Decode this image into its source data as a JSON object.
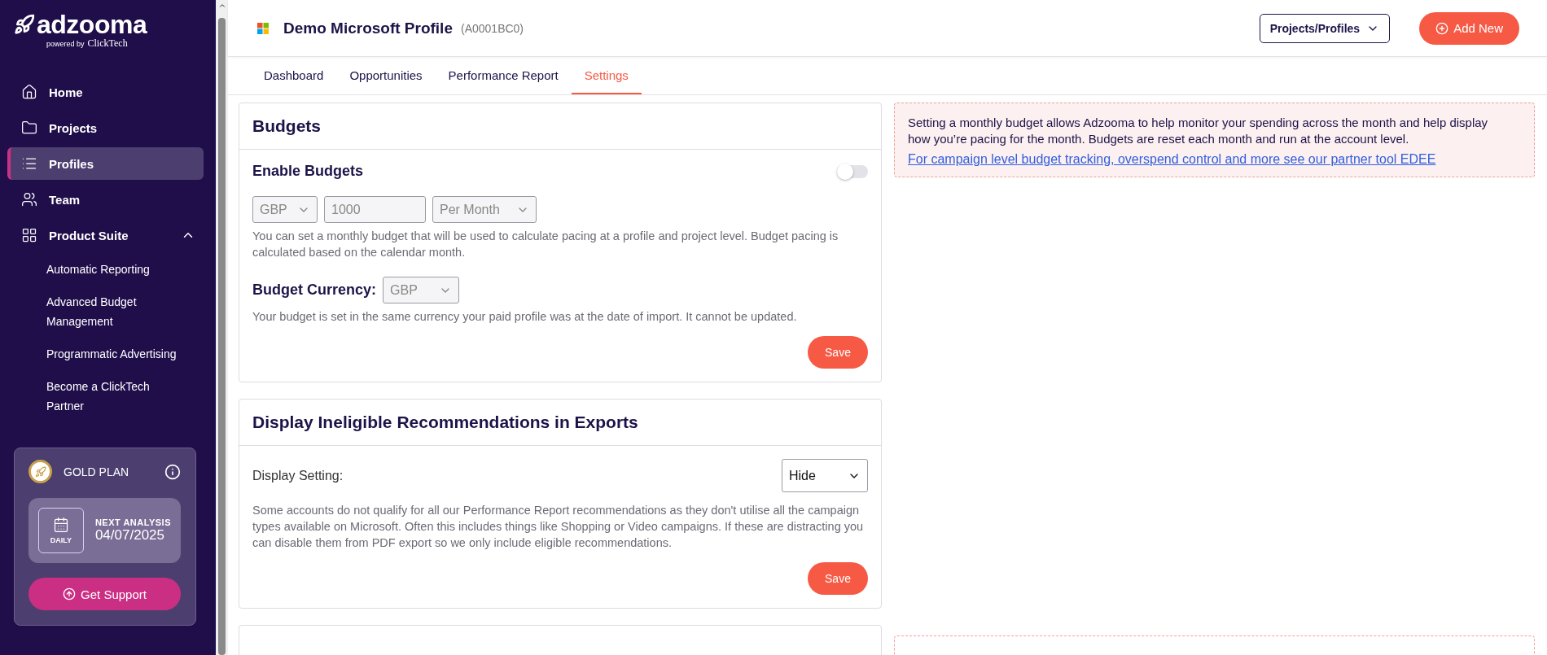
{
  "sidebar": {
    "logo": {
      "name": "adzooma",
      "tagline": "powered by",
      "brand": "ClickTech"
    },
    "items": [
      {
        "label": "Home",
        "selected": false
      },
      {
        "label": "Projects",
        "selected": false
      },
      {
        "label": "Profiles",
        "selected": true
      },
      {
        "label": "Team",
        "selected": false
      },
      {
        "label": "Product Suite",
        "selected": false,
        "expanded": true,
        "children": [
          {
            "label": "Automatic Reporting"
          },
          {
            "label": "Advanced Budget Management"
          },
          {
            "label": "Programmatic Advertising"
          },
          {
            "label": "Become a ClickTech Partner"
          }
        ]
      }
    ],
    "plan": {
      "name": "GOLD PLAN",
      "frequency": "DAILY",
      "next_label": "NEXT ANALYSIS",
      "next_date": "04/07/2025",
      "support_button": "Get Support"
    }
  },
  "header": {
    "title": "Demo Microsoft Profile",
    "id": "(A0001BC0)",
    "projects_button": "Projects/Profiles",
    "add_button": "Add New"
  },
  "tabs": [
    {
      "label": "Dashboard",
      "selected": false
    },
    {
      "label": "Opportunities",
      "selected": false
    },
    {
      "label": "Performance Report",
      "selected": false
    },
    {
      "label": "Settings",
      "selected": true
    }
  ],
  "budgets": {
    "title": "Budgets",
    "enable_label": "Enable Budgets",
    "enabled": false,
    "currency": "GBP",
    "amount_placeholder": "1000",
    "period": "Per Month",
    "help": "You can set a monthly budget that will be used to calculate pacing at a profile and project level. Budget pacing is calculated based on the calendar month.",
    "currency_label": "Budget Currency:",
    "currency_value": "GBP",
    "currency_help": "Your budget is set in the same currency your paid profile was at the date of import. It cannot be updated.",
    "save": "Save"
  },
  "budgets_info": {
    "text": "Setting a monthly budget allows Adzooma to help monitor your spending across the month and help display how you’re pacing for the month. Budgets are reset each month and run at the account level.",
    "link": "For campaign level budget tracking, overspend control and more see our partner tool EDEE"
  },
  "display": {
    "title": "Display Ineligible Recommendations in Exports",
    "setting_label": "Display Setting:",
    "setting_value": "Hide",
    "help": "Some accounts do not qualify for all our Performance Report recommendations as they don't utilise all the campaign types available on Microsoft. Often this includes things like Shopping or Video campaigns. If these are distracting you can disable them from PDF export so we only include eligible recommendations.",
    "save": "Save"
  }
}
